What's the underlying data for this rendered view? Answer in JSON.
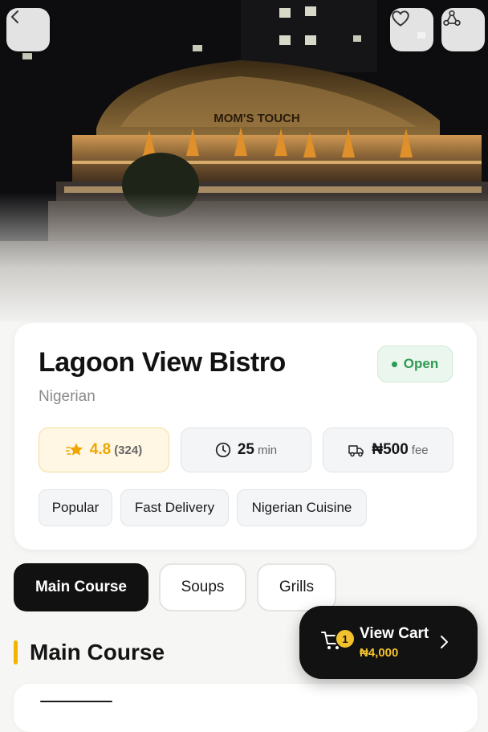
{
  "hero": {
    "sign_text": "MOM'S TOUCH"
  },
  "icons": {
    "back": "chevron-left-icon",
    "favorite": "heart-icon",
    "share": "share-icon",
    "rating": "star-icon",
    "time": "clock-icon",
    "fee": "delivery-truck-icon",
    "cart": "cart-icon",
    "cart_arrow": "chevron-right-icon"
  },
  "restaurant": {
    "name": "Lagoon View Bistro",
    "cuisine": "Nigerian",
    "status": "Open",
    "rating": "4.8",
    "reviews": "(324)",
    "delivery_time": "25",
    "delivery_time_unit": "min",
    "delivery_fee": "₦500",
    "delivery_fee_label": "fee",
    "tags": [
      "Popular",
      "Fast Delivery",
      "Nigerian Cuisine"
    ]
  },
  "tabs": [
    {
      "label": "Main Course",
      "active": true
    },
    {
      "label": "Soups",
      "active": false
    },
    {
      "label": "Grills",
      "active": false
    }
  ],
  "section": {
    "title": "Main Course"
  },
  "cart": {
    "count": "1",
    "label": "View Cart",
    "total": "₦4,000"
  },
  "colors": {
    "accent": "#f2b400",
    "open_green": "#2e9a52",
    "dark": "#121212",
    "rating": "#f0a500"
  }
}
